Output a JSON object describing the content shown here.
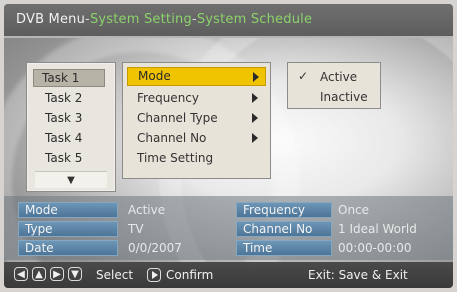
{
  "title": {
    "part1": "DVB Menu",
    "sep1": "-",
    "part2": "System Setting",
    "sep2": "-",
    "part3": "System Schedule"
  },
  "tasks": {
    "items": [
      {
        "label": "Task 1"
      },
      {
        "label": "Task 2"
      },
      {
        "label": "Task 3"
      },
      {
        "label": "Task 4"
      },
      {
        "label": "Task 5"
      }
    ],
    "scroll_down_icon": "chevron-down-icon"
  },
  "submenu": {
    "items": [
      {
        "label": "Mode",
        "has_submenu": true
      },
      {
        "label": "Frequency",
        "has_submenu": true
      },
      {
        "label": "Channel Type",
        "has_submenu": true
      },
      {
        "label": "Channel No",
        "has_submenu": true
      },
      {
        "label": "Time Setting",
        "has_submenu": false
      }
    ]
  },
  "state": {
    "items": [
      {
        "label": "Active",
        "checked": true,
        "check_glyph": "✓"
      },
      {
        "label": "Inactive",
        "checked": false,
        "check_glyph": ""
      }
    ]
  },
  "info": {
    "mode_label": "Mode",
    "mode_value": "Active",
    "type_label": "Type",
    "type_value": "TV",
    "date_label": "Date",
    "date_value": "0/0/2007",
    "frequency_label": "Frequency",
    "frequency_value": "Once",
    "channel_no_label": "Channel No",
    "channel_no_value": "1 Ideal World",
    "time_label": "Time",
    "time_value": "00:00-00:00"
  },
  "footer": {
    "keys_icons": [
      "left-key-icon",
      "up-key-icon",
      "right-key-icon",
      "down-key-icon"
    ],
    "select_label": "Select",
    "confirm_label": "Confirm",
    "exit_label": "Exit: Save & Exit"
  },
  "colors": {
    "highlight": "#f0c300",
    "label_blue": "#5b84a7",
    "title_green": "#8cd36b"
  }
}
